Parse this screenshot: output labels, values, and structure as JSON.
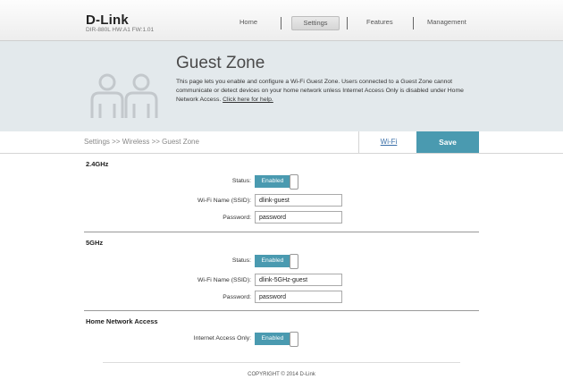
{
  "header": {
    "logo": "D-Link",
    "model": "DIR-880L   HW:A1   FW:1.01",
    "nav": [
      {
        "label": "Home"
      },
      {
        "label": "Settings"
      },
      {
        "label": "Features"
      },
      {
        "label": "Management"
      }
    ]
  },
  "hero": {
    "title": "Guest Zone",
    "description": "This page lets you enable and configure a Wi-Fi Guest Zone. Users connected to a Guest Zone cannot communicate or detect devices on your home network unless Internet Access Only is disabled under Home Network Access. ",
    "help_link": "Click here for help."
  },
  "breadcrumb": "Settings >> Wireless >> Guest Zone",
  "actions": {
    "wifi_link": "Wi-Fi",
    "save_label": "Save"
  },
  "band24": {
    "title": "2.4GHz",
    "status_label": "Status:",
    "status_value": "Enabled",
    "ssid_label": "Wi-Fi Name (SSID):",
    "ssid_value": "dlink-guest",
    "password_label": "Password:",
    "password_value": "password"
  },
  "band5": {
    "title": "5GHz",
    "status_label": "Status:",
    "status_value": "Enabled",
    "ssid_label": "Wi-Fi Name (SSID):",
    "ssid_value": "dlink-5GHz-guest",
    "password_label": "Password:",
    "password_value": "password"
  },
  "home_access": {
    "title": "Home Network Access",
    "internet_only_label": "Internet Access Only:",
    "internet_only_value": "Enabled"
  },
  "footer": {
    "copyright": "COPYRIGHT © 2014 D-Link"
  },
  "colors": {
    "accent": "#4a9ab0",
    "hero_bg": "#e3e9ec"
  }
}
